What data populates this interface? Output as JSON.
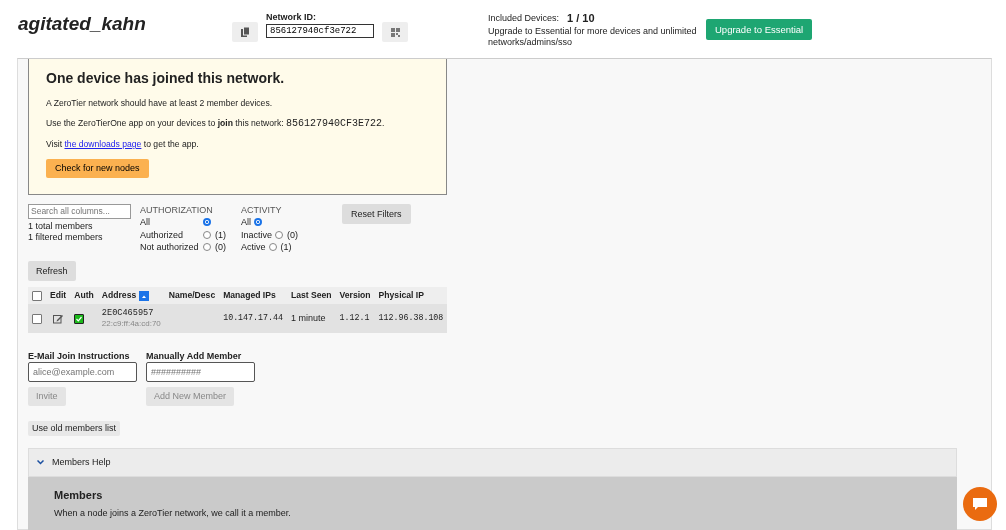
{
  "header": {
    "network_name": "agitated_kahn",
    "network_id_label": "Network ID:",
    "network_id": "856127940cf3e722",
    "included_devices_label": "Included Devices:",
    "included_devices_count": "1 / 10",
    "upgrade_text": "Upgrade to Essential for more devices and unlimited networks/admins/sso",
    "upgrade_button": "Upgrade to Essential"
  },
  "notice": {
    "title": "One device has joined this network.",
    "intro": "A ZeroTier network should have at least 2 member devices.",
    "join_text": "Use the ZeroTierOne app on your devices to **join** this network: ",
    "join_id": "856127940CF3E722",
    "join_end": ".",
    "visit_before": "Visit ",
    "visit_link": "the downloads page",
    "visit_after": " to get the app.",
    "button": "Check for new nodes"
  },
  "filters": {
    "search_placeholder": "Search all columns...",
    "total": "1 total members",
    "filtered": "1 filtered members",
    "groups": [
      {
        "title": "AUTHORIZATION",
        "options": [
          {
            "label": "All",
            "selected": true
          },
          {
            "label": "Authorized",
            "count": "(1)",
            "selected": false
          },
          {
            "label": "Not authorized",
            "count": "(0)",
            "selected": false
          }
        ]
      },
      {
        "title": "ACTIVITY",
        "options": [
          {
            "label": "All",
            "selected": true
          },
          {
            "label": "Inactive",
            "count": "(0)",
            "selected": false
          },
          {
            "label": "Active",
            "count": "(1)",
            "selected": false
          }
        ]
      }
    ],
    "reset_button": "Reset Filters"
  },
  "refresh_button": "Refresh",
  "table": {
    "select_all_checked": false,
    "columns": [
      {
        "label": "Edit",
        "sorted": false
      },
      {
        "label": "Auth",
        "sorted": false
      },
      {
        "label": "Address",
        "sorted": true
      },
      {
        "label": "Name/Desc",
        "sorted": false
      },
      {
        "label": "Managed IPs",
        "sorted": false
      },
      {
        "label": "Last Seen",
        "sorted": false
      },
      {
        "label": "Version",
        "sorted": false
      },
      {
        "label": "Physical IP",
        "sorted": false
      }
    ],
    "rows": [
      {
        "checked": false,
        "authorized": true,
        "address": "2E0C465957",
        "mac": "22:c9:ff:4a:cd:70",
        "managed_ips": "10.147.17.44",
        "last_seen": "1 minute",
        "version": "1.12.1",
        "physical_ip": "112.96.38.108"
      }
    ]
  },
  "forms": [
    {
      "label": "E-Mail Join Instructions",
      "placeholder": "alice@example.com",
      "button": "Invite",
      "disabled": true
    },
    {
      "label": "Manually Add Member",
      "placeholder": "##########",
      "button": "Add New Member",
      "disabled": true
    }
  ],
  "old_list_button": "Use old members list",
  "help": {
    "title": "Members Help",
    "expanded": true,
    "heading": "Members",
    "text": "When a node joins a ZeroTier network, we call it a member."
  }
}
